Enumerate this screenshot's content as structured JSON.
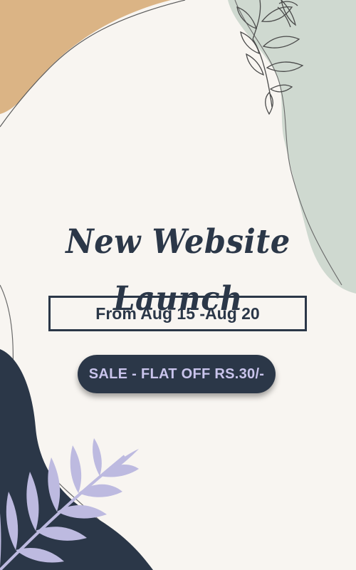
{
  "poster": {
    "title": "New Website Launch",
    "date_range": "From Aug 15 -Aug 20",
    "sale": "SALE - FLAT OFF RS.30/-"
  },
  "colors": {
    "background": "#f8f5f1",
    "navy": "#2b3748",
    "tan_blob": "#dbb485",
    "sage_blob": "#cfd9d0",
    "lavender_leaves": "#bdbae0",
    "sale_text": "#c9c4ec"
  }
}
